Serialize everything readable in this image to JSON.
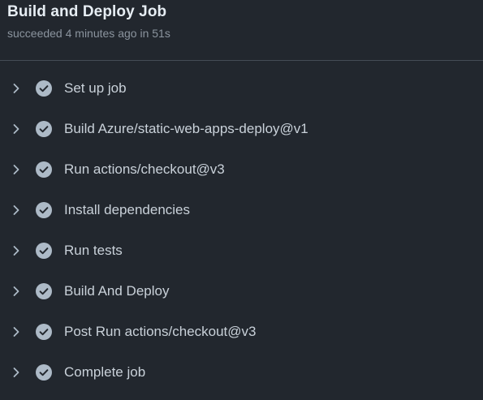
{
  "job": {
    "title": "Build and Deploy Job",
    "status_word": "succeeded",
    "time_ago": "4 minutes ago",
    "duration_prefix": "in",
    "duration": "51s"
  },
  "steps": [
    {
      "label": "Set up job",
      "status": "success"
    },
    {
      "label": "Build Azure/static-web-apps-deploy@v1",
      "status": "success"
    },
    {
      "label": "Run actions/checkout@v3",
      "status": "success"
    },
    {
      "label": "Install dependencies",
      "status": "success"
    },
    {
      "label": "Run tests",
      "status": "success"
    },
    {
      "label": "Build And Deploy",
      "status": "success"
    },
    {
      "label": "Post Run actions/checkout@v3",
      "status": "success"
    },
    {
      "label": "Complete job",
      "status": "success"
    }
  ],
  "colors": {
    "background": "#22272e",
    "title": "#e6edf3",
    "muted": "#8b949e",
    "step_text": "#c9d1d9",
    "check_fill": "#adbac7",
    "divider": "#444c56"
  },
  "icons": {
    "expand": "chevron-right-icon",
    "status": "check-circle-icon"
  }
}
